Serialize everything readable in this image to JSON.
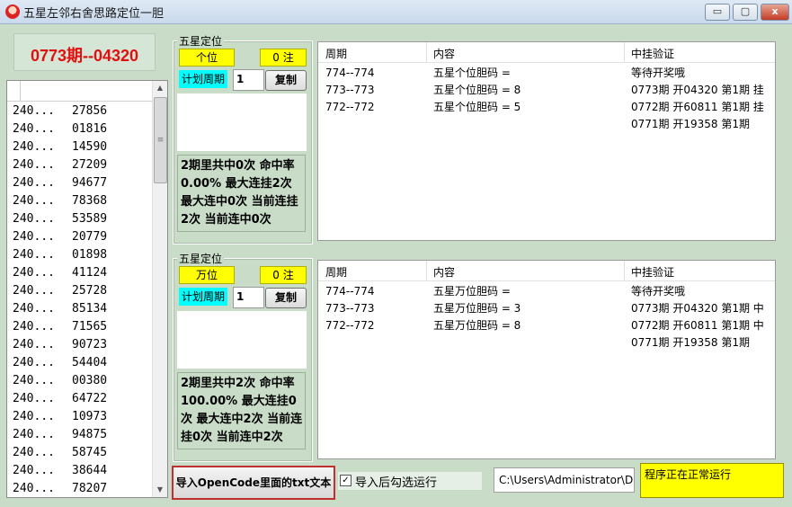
{
  "window": {
    "title": "五星左邻右舍思路定位一胆",
    "min_glyph": "▭",
    "restore_glyph": "▢",
    "close_glyph": "x"
  },
  "period_display": "0773期--04320",
  "history_rows": [
    {
      "period": "240...",
      "number": "27856"
    },
    {
      "period": "240...",
      "number": "01816"
    },
    {
      "period": "240...",
      "number": "14590"
    },
    {
      "period": "240...",
      "number": "27209"
    },
    {
      "period": "240...",
      "number": "94677"
    },
    {
      "period": "240...",
      "number": "78368"
    },
    {
      "period": "240...",
      "number": "53589"
    },
    {
      "period": "240...",
      "number": "20779"
    },
    {
      "period": "240...",
      "number": "01898"
    },
    {
      "period": "240...",
      "number": "41124"
    },
    {
      "period": "240...",
      "number": "25728"
    },
    {
      "period": "240...",
      "number": "85134"
    },
    {
      "period": "240...",
      "number": "71565"
    },
    {
      "period": "240...",
      "number": "90723"
    },
    {
      "period": "240...",
      "number": "54404"
    },
    {
      "period": "240...",
      "number": "00380"
    },
    {
      "period": "240...",
      "number": "64722"
    },
    {
      "period": "240...",
      "number": "10973"
    },
    {
      "period": "240...",
      "number": "94875"
    },
    {
      "period": "240...",
      "number": "58745"
    },
    {
      "period": "240...",
      "number": "38644"
    },
    {
      "period": "240...",
      "number": "78207"
    }
  ],
  "groups": [
    {
      "title": "五星定位",
      "position": "个位",
      "bets": "0 注",
      "plan_label": "计划周期",
      "plan_value": "1",
      "copy_label": "复制",
      "stats": "2期里共中0次 命中率0.00% 最大连挂2次 最大连中0次 当前连挂2次 当前连中0次"
    },
    {
      "title": "五星定位",
      "position": "万位",
      "bets": "0 注",
      "plan_label": "计划周期",
      "plan_value": "1",
      "copy_label": "复制",
      "stats": "2期里共中2次 命中率100.00% 最大连挂0次 最大连中2次 当前连挂0次 当前连中2次"
    }
  ],
  "result_panels": [
    {
      "columns": [
        "周期",
        "内容",
        "中挂验证"
      ],
      "rows": [
        {
          "period": "774--774",
          "content": "五星个位胆码 =",
          "verify": "等待开奖哦"
        },
        {
          "period": "773--773",
          "content": "五星个位胆码 = 8",
          "verify": "0773期 开04320 第1期 挂"
        },
        {
          "period": "772--772",
          "content": "五星个位胆码 = 5",
          "verify": "0772期 开60811 第1期 挂"
        },
        {
          "period": "",
          "content": "",
          "verify": "0771期 开19358 第1期"
        }
      ]
    },
    {
      "columns": [
        "周期",
        "内容",
        "中挂验证"
      ],
      "rows": [
        {
          "period": "774--774",
          "content": "五星万位胆码 =",
          "verify": "等待开奖哦"
        },
        {
          "period": "773--773",
          "content": "五星万位胆码 = 3",
          "verify": "0773期 开04320 第1期 中"
        },
        {
          "period": "772--772",
          "content": "五星万位胆码 = 8",
          "verify": "0772期 开60811 第1期 中"
        },
        {
          "period": "",
          "content": "",
          "verify": "0771期 开19358 第1期"
        }
      ]
    }
  ],
  "import_button": "导入OpenCode里面的txt文本",
  "auto_run": {
    "label": "导入后勾选运行",
    "checked": true,
    "check_glyph": "✓"
  },
  "path_value": "C:\\Users\\Administrator\\De",
  "status_text": "程序正在正常运行",
  "colors": {
    "highlight_yellow": "#ffff00",
    "cyan": "#00ffff",
    "period_red": "#e01010",
    "bg_green": "#c8dcc8"
  }
}
